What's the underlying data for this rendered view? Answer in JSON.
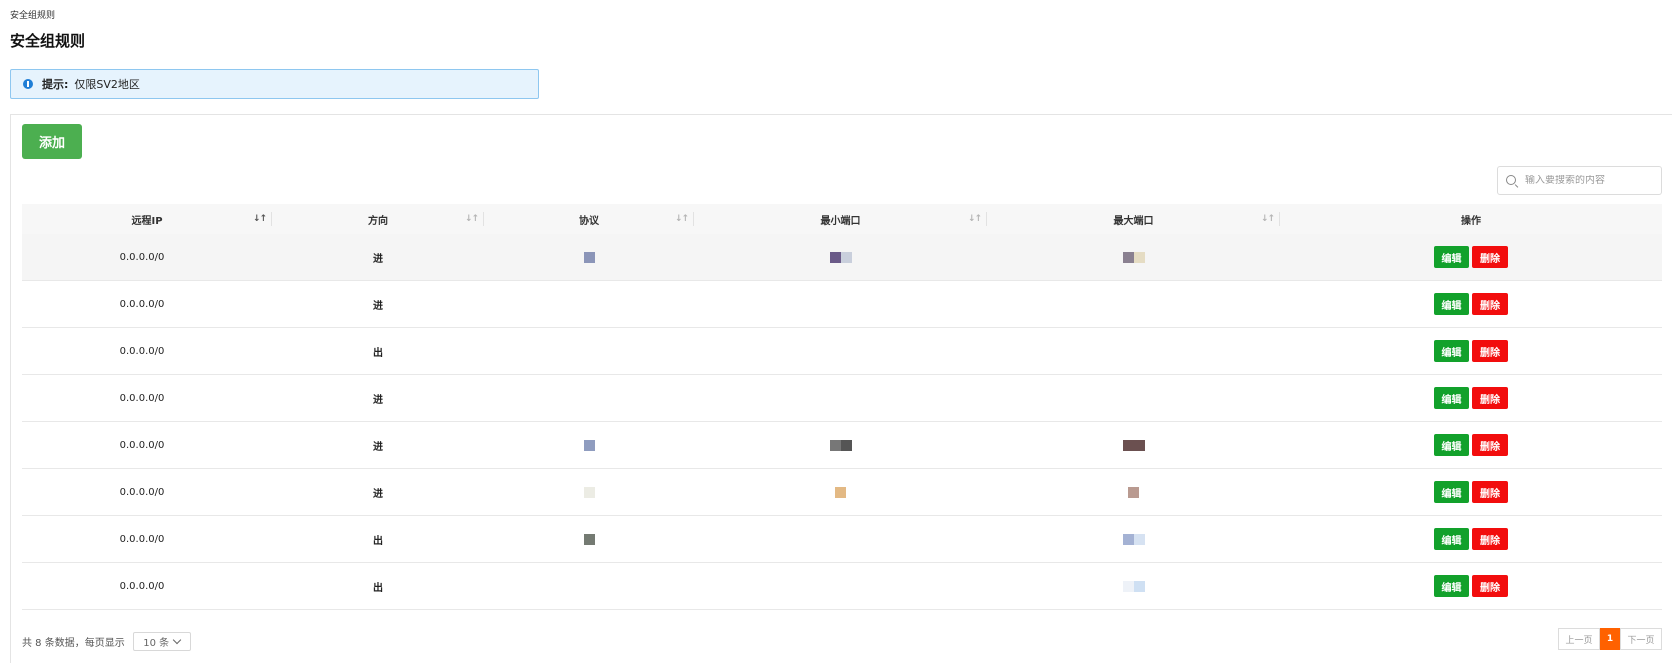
{
  "breadcrumb": "安全组规则",
  "page_title": "安全组规则",
  "notice": {
    "label": "提示:",
    "text": "仅限SV2地区"
  },
  "add_button": "添加",
  "search": {
    "placeholder": "输入要搜索的内容"
  },
  "columns": [
    "远程IP",
    "方向",
    "协议",
    "最小端口",
    "最大端口",
    "操作"
  ],
  "rows": [
    {
      "ip": "0.0.0.0/0",
      "direction": "进"
    },
    {
      "ip": "0.0.0.0/0",
      "direction": "进"
    },
    {
      "ip": "0.0.0.0/0",
      "direction": "出"
    },
    {
      "ip": "0.0.0.0/0",
      "direction": "进"
    },
    {
      "ip": "0.0.0.0/0",
      "direction": "进"
    },
    {
      "ip": "0.0.0.0/0",
      "direction": "进"
    },
    {
      "ip": "0.0.0.0/0",
      "direction": "出"
    },
    {
      "ip": "0.0.0.0/0",
      "direction": "出"
    }
  ],
  "actions": {
    "edit": "编辑",
    "delete": "删除"
  },
  "footer": {
    "total_text": "共 8 条数据，每页显示",
    "page_size": "10 条"
  },
  "pager": {
    "prev": "上一页",
    "current": "1",
    "next": "下一页"
  },
  "colors": {
    "accent_green": "#4caf50",
    "edit_green": "#12a12b",
    "delete_red": "#f20d0d",
    "pager_orange": "#ff6100",
    "notice_bg": "#e6f3fd"
  }
}
